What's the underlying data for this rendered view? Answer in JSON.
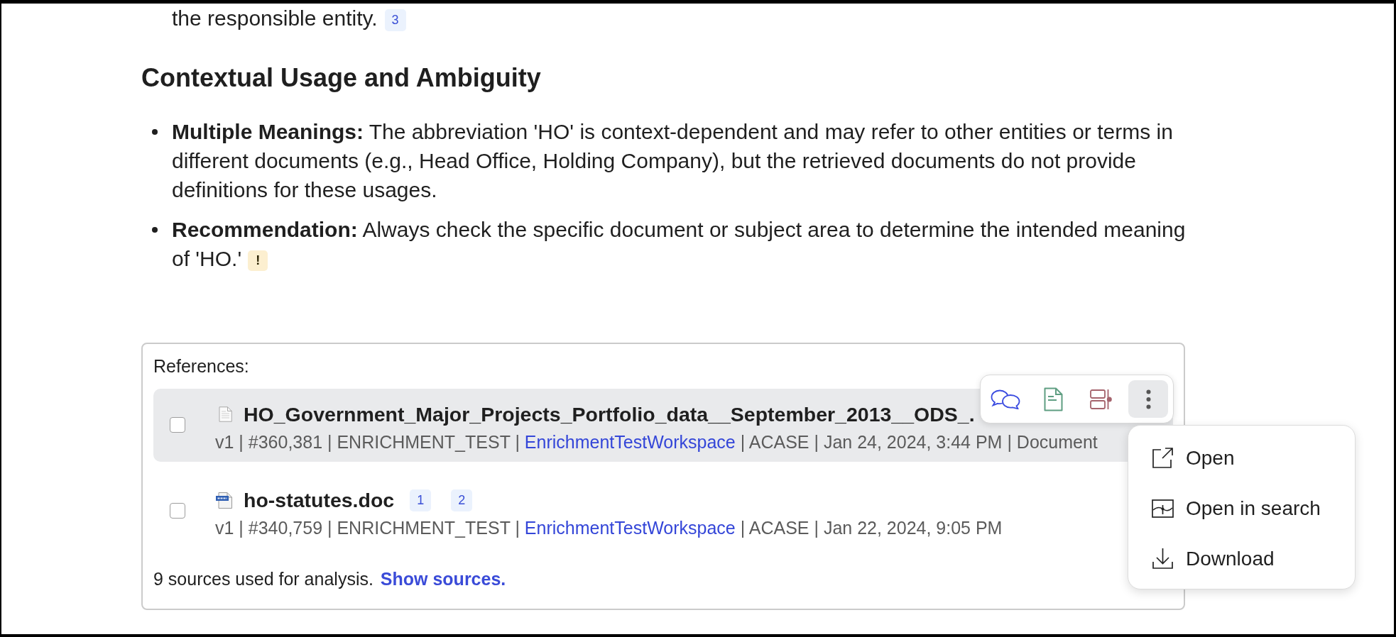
{
  "intro": {
    "text": "the responsible entity.",
    "citations": [
      {
        "label": "3",
        "kind": "source"
      }
    ]
  },
  "section": {
    "heading": "Contextual Usage and Ambiguity",
    "bullets": [
      {
        "text": "**Multiple Meanings:** The abbreviation 'HO' is context-dependent and may refer to other entities or terms in different documents (e.g., Head Office, Holding Company), but the retrieved documents do not provide definitions for these usages."
      },
      {
        "text": "**Recommendation:** Always check the specific document or subject area to determine the intended meaning of 'HO.'",
        "citations": [
          {
            "label": "!",
            "kind": "warning"
          }
        ]
      }
    ]
  },
  "references": {
    "title": "References:",
    "items": [
      {
        "kind": "file",
        "title": "HO_Government_Major_Projects_Portfolio_data__September_2013__ODS_.",
        "checked": false,
        "hovered": true,
        "details": [
          {
            "kind": "text",
            "text": "v1 | #360,381 | ENRICHMENT_TEST |"
          },
          {
            "kind": "link",
            "text": "EnrichmentTestWorkspace"
          },
          {
            "kind": "text",
            "text": "| ACASE | Jan 24, 2024, 3:44 PM | Document"
          }
        ]
      },
      {
        "kind": "doc",
        "title": "ho-statutes.doc",
        "checked": false,
        "hovered": false,
        "citations": [
          {
            "label": "1",
            "kind": "source"
          },
          {
            "label": "2",
            "kind": "source"
          }
        ],
        "details": [
          {
            "kind": "text",
            "text": "v1 | #340,759 | ENRICHMENT_TEST |"
          },
          {
            "kind": "link",
            "text": "EnrichmentTestWorkspace"
          },
          {
            "kind": "text",
            "text": "| ACASE | Jan 22, 2024, 9:05 PM"
          }
        ]
      }
    ],
    "summary": {
      "text": "9 sources used for analysis.",
      "link": "Show sources."
    },
    "actions_menu": {
      "open": true,
      "items": [
        {
          "kind": "open",
          "label": "Open"
        },
        {
          "kind": "search",
          "label": "Open in search"
        },
        {
          "kind": "download",
          "label": "Download"
        }
      ]
    }
  }
}
